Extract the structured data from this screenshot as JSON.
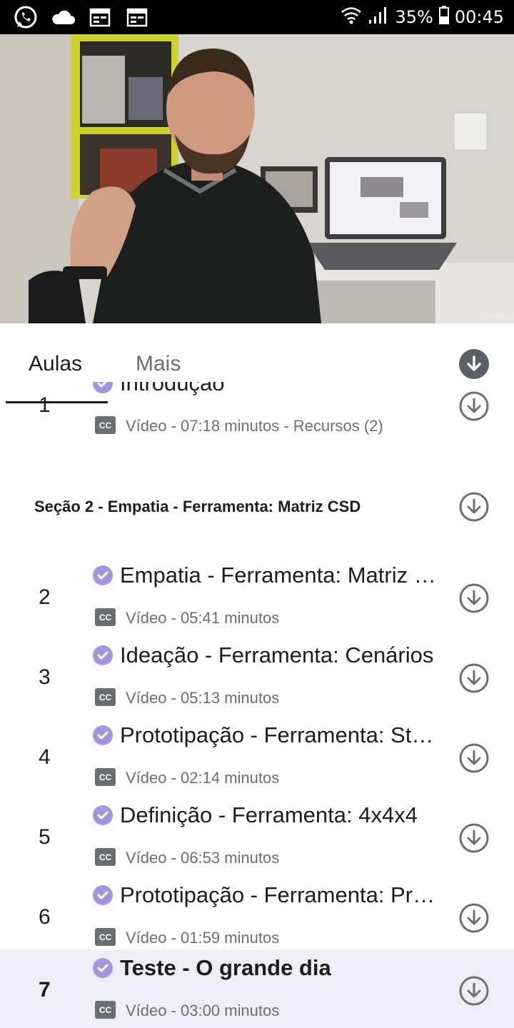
{
  "status_bar": {
    "battery": "35%",
    "time": "00:45",
    "icons": [
      "whatsapp-icon",
      "cloud-icon",
      "calendar-icon",
      "calendar-icon",
      "wifi-icon",
      "signal-icon",
      "battery-icon"
    ]
  },
  "tabs": [
    {
      "label": "Aulas",
      "selected": true
    },
    {
      "label": "Mais",
      "selected": false
    }
  ],
  "partial_lecture": {
    "number": "1",
    "title": "Introdução",
    "meta": "Vídeo - 07:18 minutos - Recursos (2)"
  },
  "section": {
    "title": "Seção 2 - Empatia - Ferramenta: Matriz CSD"
  },
  "lectures": [
    {
      "number": "2",
      "title": "Empatia - Ferramenta: Matriz CSD",
      "meta": "Vídeo - 05:41 minutos"
    },
    {
      "number": "3",
      "title": "Ideação - Ferramenta: Cenários",
      "meta": "Vídeo - 05:13 minutos"
    },
    {
      "number": "4",
      "title": "Prototipação - Ferramenta: Storyboard",
      "meta": "Vídeo - 02:14 minutos"
    },
    {
      "number": "5",
      "title": "Definição - Ferramenta: 4x4x4",
      "meta": "Vídeo - 06:53 minutos"
    },
    {
      "number": "6",
      "title": "Prototipação - Ferramenta: Protótipo",
      "meta": "Vídeo - 01:59 minutos"
    },
    {
      "number": "7",
      "title": "Teste - O grande dia",
      "meta": "Vídeo - 03:00 minutos",
      "active": true
    }
  ],
  "cc_label": "CC",
  "colors": {
    "accent_check": "#a694df",
    "active_row_bg": "#efedf8",
    "icon_gray": "#6a6f73"
  }
}
